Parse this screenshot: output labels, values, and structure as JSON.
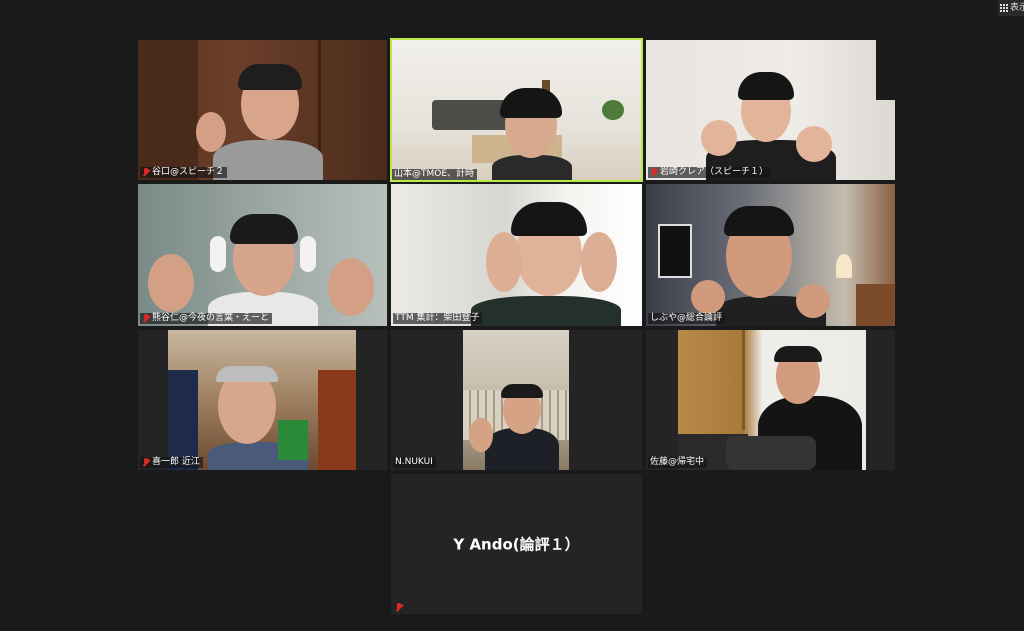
{
  "toolbar": {
    "view_label": "表示"
  },
  "participants": [
    {
      "name": "谷口@スピーチ２",
      "muted": true
    },
    {
      "name": "山本@TMOE、計時",
      "muted": false,
      "speaking": true
    },
    {
      "name": "岩崎クレア（スピーチ１）",
      "muted": true
    },
    {
      "name": "熊谷仁@今夜の言葉・えーと",
      "muted": true
    },
    {
      "name": "TTM 集計：柴田登子",
      "muted": false
    },
    {
      "name": "しぶや@総合論評",
      "muted": false
    },
    {
      "name": "喜一郎 近江",
      "muted": true
    },
    {
      "name": "N.NUKUI",
      "muted": false
    },
    {
      "name": "佐藤@帰宅中",
      "muted": false
    },
    {
      "name": "Y Ando(論評１）",
      "muted": true,
      "video_off": true
    }
  ]
}
